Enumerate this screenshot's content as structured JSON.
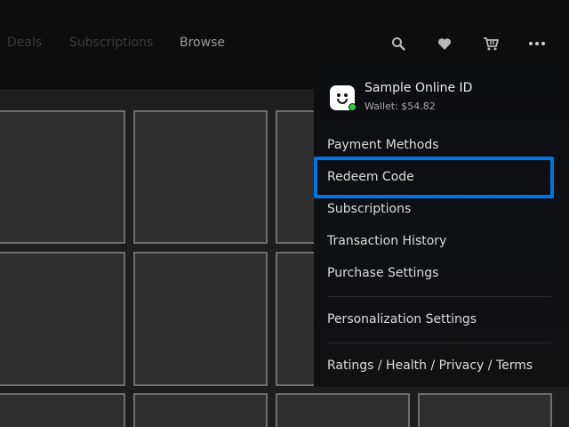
{
  "nav": {
    "tabs": [
      {
        "label": "Deals"
      },
      {
        "label": "Subscriptions"
      },
      {
        "label": "Browse"
      }
    ],
    "icons": [
      "search-icon",
      "heart-icon",
      "cart-icon",
      "more-icon"
    ]
  },
  "profile": {
    "online_id": "Sample Online ID",
    "wallet": "Wallet: $54.82",
    "status": "online"
  },
  "menu": {
    "items": [
      {
        "label": "Payment Methods"
      },
      {
        "label": "Redeem Code",
        "focused": true
      },
      {
        "label": "Subscriptions"
      },
      {
        "label": "Transaction History"
      },
      {
        "label": "Purchase Settings"
      },
      {
        "label": "Personalization Settings"
      },
      {
        "label": "Ratings / Health / Privacy / Terms"
      }
    ]
  },
  "colors": {
    "focus": "#0072e3",
    "online": "#2ecc40",
    "tile_border": "#6e6e6e"
  }
}
